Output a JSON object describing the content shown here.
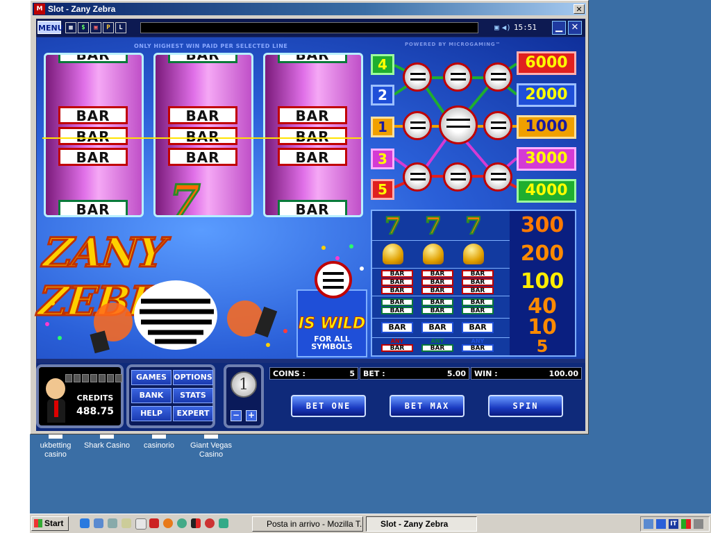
{
  "window": {
    "title": "Slot - Zany Zebra",
    "close_glyph": "✕"
  },
  "menubar": {
    "menu_label": "MENU",
    "mini_icons": [
      "▦",
      "$",
      "▣",
      "P",
      "L"
    ],
    "clock": "15:51",
    "minimize_glyph": "▁",
    "close_glyph": "✕"
  },
  "game": {
    "top_note": "ONLY HIGHEST WIN PAID PER SELECTED LINE",
    "powered": "POWERED BY MICROGAMING™",
    "logo": "ZANY ZEBRA",
    "reels": [
      {
        "top": "BAR",
        "stack": [
          "BAR",
          "BAR",
          "BAR"
        ],
        "bottom": "BAR"
      },
      {
        "top": "BAR",
        "stack": [
          "BAR",
          "BAR",
          "BAR"
        ],
        "bottom": "7"
      },
      {
        "top": "BAR",
        "stack": [
          "BAR",
          "BAR",
          "BAR"
        ],
        "bottom": "BAR"
      }
    ],
    "wild": {
      "is_wild": "IS WILD",
      "for_all_1": "FOR ALL",
      "for_all_2": "SYMBOLS"
    },
    "lines": [
      {
        "num": "4",
        "color": "#1fae2f",
        "text": "#ffff00"
      },
      {
        "num": "2",
        "color": "#1f4fd8",
        "text": "#ffffff"
      },
      {
        "num": "1",
        "color": "#f0a000",
        "text": "#1a1aa0"
      },
      {
        "num": "3",
        "color": "#d43bd4",
        "text": "#ffff00"
      },
      {
        "num": "5",
        "color": "#e02020",
        "text": "#ffff00"
      }
    ],
    "line_pays": [
      {
        "value": "6000",
        "bg": "#e02020",
        "text": "#ffff00"
      },
      {
        "value": "2000",
        "bg": "#1f4fd8",
        "text": "#ffff00"
      },
      {
        "value": "1000",
        "bg": "#f0a000",
        "text": "#1a1aa0"
      },
      {
        "value": "3000",
        "bg": "#d43bd4",
        "text": "#ffff00"
      },
      {
        "value": "4000",
        "bg": "#1fae2f",
        "text": "#ffff00"
      }
    ],
    "paytable": [
      {
        "symbol": "seven",
        "amount": "300",
        "color": "#ff7a00"
      },
      {
        "symbol": "bell",
        "amount": "200",
        "color": "#ff8a00"
      },
      {
        "symbol": "triple-bar",
        "amount": "100",
        "color": "#ffee00"
      },
      {
        "symbol": "double-bar",
        "amount": "40",
        "color": "#ff8a00"
      },
      {
        "symbol": "single-bar",
        "amount": "10",
        "color": "#ff8a00"
      },
      {
        "symbol": "any-bar",
        "amount": "5",
        "color": "#ff8a00"
      }
    ],
    "bar_text": "BAR",
    "any_text": "ANY",
    "seven_glyph": "7"
  },
  "bottom": {
    "credits_label": "CREDITS",
    "credits_value": "488.75",
    "nav": {
      "games": "GAMES",
      "options": "OPTIONS",
      "bank": "BANK",
      "stats": "STATS",
      "help": "HELP",
      "expert": "EXPERT"
    },
    "coin_value": "1",
    "minus_glyph": "−",
    "plus_glyph": "+",
    "coins_label": "COINS :",
    "coins_value": "5",
    "bet_label": "BET :",
    "bet_value": "5.00",
    "win_label": "WIN :",
    "win_value": "100.00",
    "bet_one": "BET ONE",
    "bet_max": "BET MAX",
    "spin": "SPIN"
  },
  "desktop_icons": [
    {
      "line1": "ukbetting",
      "line2": "casino"
    },
    {
      "line1": "Shark Casino",
      "line2": ""
    },
    {
      "line1": "casinorio",
      "line2": ""
    },
    {
      "line1": "Giant Vegas",
      "line2": "Casino"
    }
  ],
  "taskbar": {
    "start": "Start",
    "task1": "Posta in arrivo - Mozilla T...",
    "task2": "Slot - Zany Zebra"
  }
}
